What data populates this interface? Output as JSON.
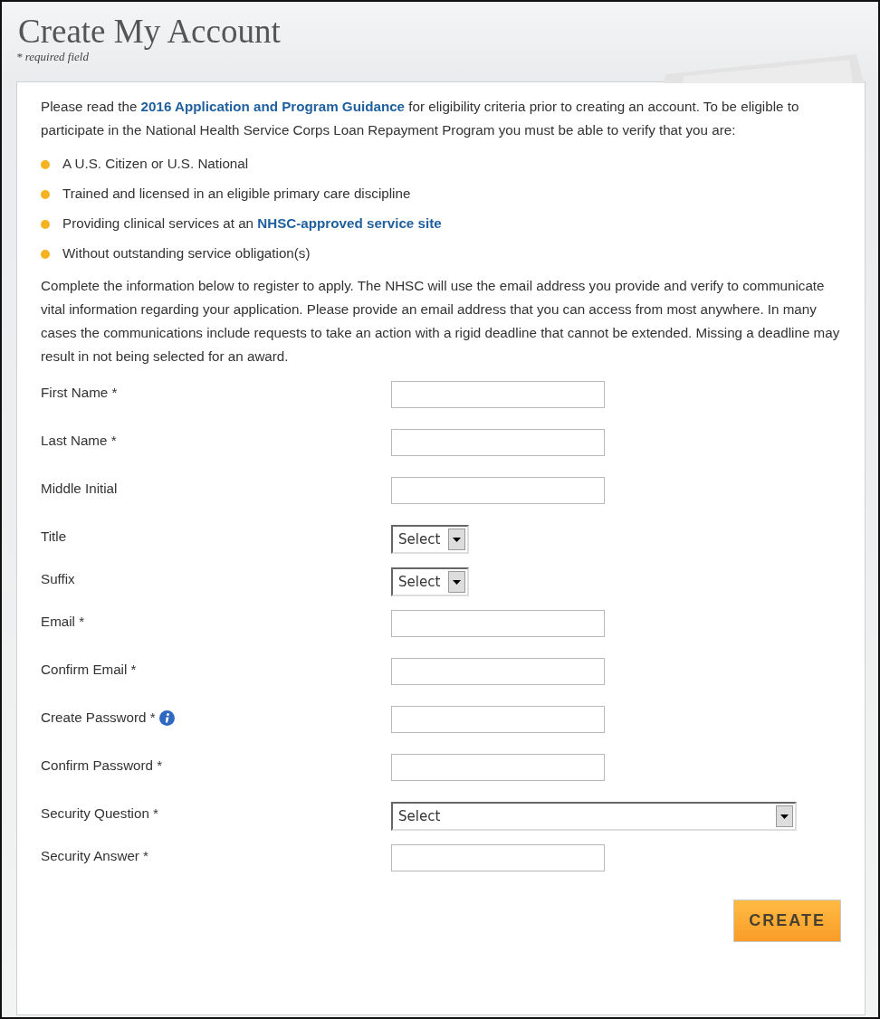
{
  "header": {
    "title": "Create My Account",
    "note": "* required field"
  },
  "intro": [
    {
      "kind": "text",
      "text": "Please read the "
    },
    {
      "kind": "link",
      "text": "2016 Application and Program Guidance"
    },
    {
      "kind": "text",
      "text": " for eligibility criteria prior to creating an account. To be eligible to participate in the National Health Service Corps Loan Repayment Program you must be able to verify that you are:"
    }
  ],
  "bullets": [
    [
      {
        "kind": "text",
        "text": "A U.S. Citizen or U.S. National"
      }
    ],
    [
      {
        "kind": "text",
        "text": "Trained and licensed in an eligible primary care discipline"
      }
    ],
    [
      {
        "kind": "text",
        "text": "Providing clinical services at an "
      },
      {
        "kind": "link",
        "text": "NHSC-approved service site"
      }
    ],
    [
      {
        "kind": "text",
        "text": "Without outstanding service obligation(s)"
      }
    ]
  ],
  "instructions": "Complete the information below to register to apply. The NHSC will use the email address you provide and verify to communicate vital information regarding your application. Please provide an email address that you can access from most anywhere. In many cases the communications include requests to take an action with a rigid deadline that cannot be extended. Missing a deadline may result in not being selected for an award.",
  "fields": [
    {
      "label": "First Name *",
      "kind": "text"
    },
    {
      "label": "Last Name *",
      "kind": "text"
    },
    {
      "label": "Middle Initial",
      "kind": "text"
    },
    {
      "label": "Title",
      "kind": "select",
      "value": "Select"
    },
    {
      "label": "Suffix",
      "kind": "select",
      "value": "Select"
    },
    {
      "label": "Email *",
      "kind": "text"
    },
    {
      "label": "Confirm Email *",
      "kind": "text"
    },
    {
      "label": "Create Password *",
      "kind": "text",
      "info": true
    },
    {
      "label": "Confirm Password *",
      "kind": "text"
    },
    {
      "label": "Security Question *",
      "kind": "wide-select",
      "value": "Select"
    },
    {
      "label": "Security Answer *",
      "kind": "text"
    }
  ],
  "submit": "CREATE"
}
